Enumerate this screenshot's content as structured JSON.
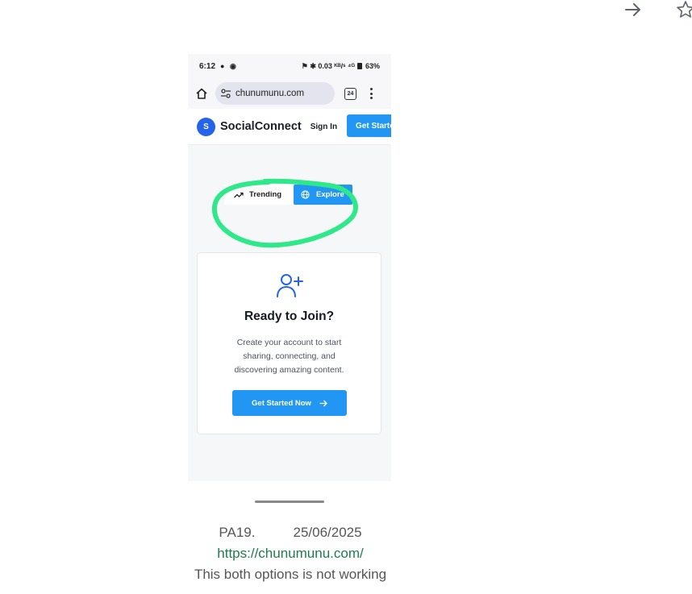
{
  "browser_toolbar": {
    "icons": [
      "arrow-right-icon",
      "star-icon"
    ]
  },
  "phone": {
    "status_bar": {
      "time": "6:12",
      "indicators": "⚑ ✱ 0.03 ᴷᴮ/ˢ ⁴ᴳ",
      "battery": "63%"
    },
    "browser": {
      "url": "chunumunu.com",
      "tab_count": "24"
    },
    "site": {
      "logo_letter": "S",
      "brand": "SocialConnect",
      "sign_in": "Sign In",
      "get_started": "Get Started"
    },
    "toggle": {
      "trending": "Trending",
      "explore": "Explore",
      "active": "explore"
    },
    "card": {
      "title": "Ready to Join?",
      "text": "Create your account to start sharing, connecting, and discovering amazing content.",
      "cta": "Get Started Now"
    },
    "annotation_color": "#2ee88a",
    "accent": "#2196f3"
  },
  "caption": {
    "id": "PA19.",
    "date": "25/06/2025",
    "link": "https://chunumunu.com/",
    "note": "This both options is not working"
  }
}
